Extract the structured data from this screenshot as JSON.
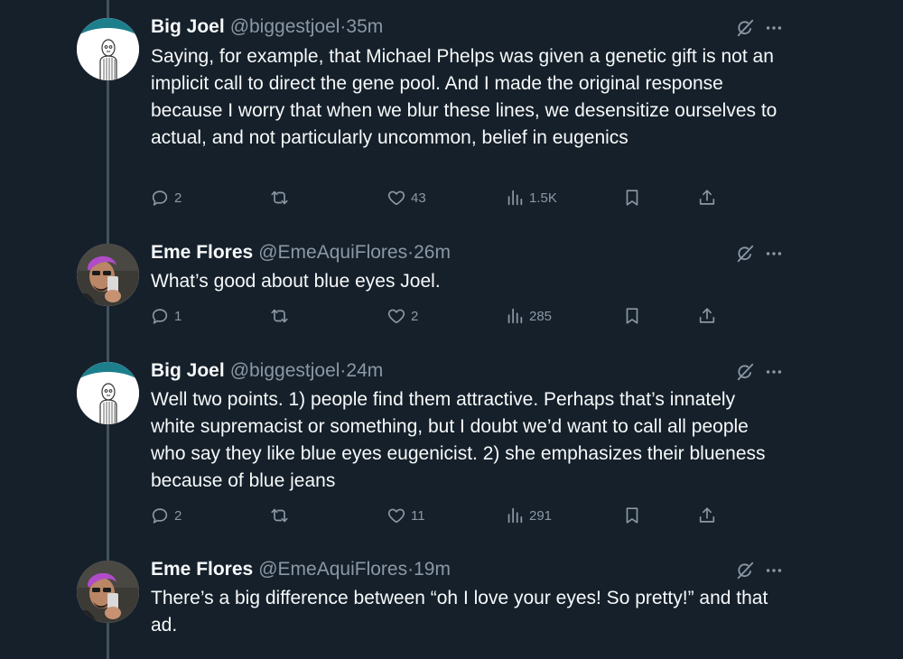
{
  "tweets": [
    {
      "name": "Big Joel",
      "handle": "@biggestjoel",
      "sep": "·",
      "time": "35m",
      "text": "Saying, for example, that Michael Phelps was given a genetic gift is not an implicit call to direct the gene pool. And I made the original response because I worry that when we blur these lines, we desensitize ourselves to actual, and not particularly uncommon, belief in eugenics",
      "replies": "2",
      "reposts": "",
      "likes": "43",
      "views": "1.5K"
    },
    {
      "name": "Eme Flores",
      "handle": "@EmeAquiFlores",
      "sep": "·",
      "time": "26m",
      "text": "What’s good about blue eyes Joel.",
      "replies": "1",
      "reposts": "",
      "likes": "2",
      "views": "285"
    },
    {
      "name": "Big Joel",
      "handle": "@biggestjoel",
      "sep": "·",
      "time": "24m",
      "text": "Well two points. 1) people find them attractive. Perhaps that’s innately white supremacist or something, but I doubt we’d want to call all people who say they like blue eyes eugenicist. 2) she emphasizes their blueness because of blue jeans",
      "replies": "2",
      "reposts": "",
      "likes": "11",
      "views": "291"
    },
    {
      "name": "Eme Flores",
      "handle": "@EmeAquiFlores",
      "sep": "·",
      "time": "19m",
      "text": "There’s a big difference between “oh I love your eyes! So pretty!” and that ad."
    }
  ],
  "colors": {
    "background": "#15202b",
    "text": "#f7f9f9",
    "muted": "#8b98a5",
    "thread_line": "#42535f",
    "avatar_joel_bg": "#1d7f8c",
    "avatar_eme_hair": "#b04cc8"
  },
  "icons": [
    "grok-icon",
    "more-icon",
    "reply-icon",
    "repost-icon",
    "like-icon",
    "views-icon",
    "bookmark-icon",
    "share-icon"
  ]
}
